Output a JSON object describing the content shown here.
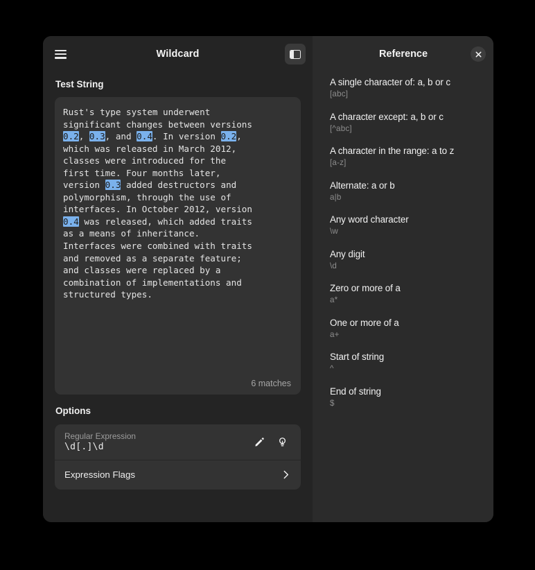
{
  "window": {
    "title": "Wildcard"
  },
  "header": {
    "menu_icon": "hamburger-icon",
    "title": "Wildcard",
    "sidebar_toggle_icon": "sidebar-toggle-icon"
  },
  "test_string": {
    "label": "Test String",
    "segments": [
      {
        "text": "Rust's type system underwent\nsignificant changes between versions\n",
        "match": false
      },
      {
        "text": "0.2",
        "match": true
      },
      {
        "text": ", ",
        "match": false
      },
      {
        "text": "0.3",
        "match": true
      },
      {
        "text": ", and ",
        "match": false
      },
      {
        "text": "0.4",
        "match": true
      },
      {
        "text": ". In version ",
        "match": false
      },
      {
        "text": "0.2",
        "match": true
      },
      {
        "text": ",\nwhich was released in March 2012,\nclasses were introduced for the\nfirst time. Four months later,\nversion ",
        "match": false
      },
      {
        "text": "0.3",
        "match": true
      },
      {
        "text": " added destructors and\npolymorphism, through the use of\ninterfaces. In October 2012, version\n",
        "match": false
      },
      {
        "text": "0.4",
        "match": true
      },
      {
        "text": " was released, which added traits\nas a means of inheritance.\nInterfaces were combined with traits\nand removed as a separate feature;\nand classes were replaced by a\ncombination of implementations and\nstructured types.",
        "match": false
      }
    ],
    "plain_text": "Rust's type system underwent significant changes between versions 0.2, 0.3, and 0.4. In version 0.2, which was released in March 2012, classes were introduced for the first time. Four months later, version 0.3 added destructors and polymorphism, through the use of interfaces. In October 2012, version 0.4 was released, which added traits as a means of inheritance. Interfaces were combined with traits and removed as a separate feature; and classes were replaced by a combination of implementations and structured types.",
    "match_count_label": "6 matches",
    "match_highlight_color": "#7ab1ec"
  },
  "options": {
    "label": "Options",
    "regex": {
      "field_label": "Regular Expression",
      "value": "\\d[.]\\d",
      "edit_icon": "pencil-icon",
      "hint_icon": "lightbulb-icon"
    },
    "flags": {
      "label": "Expression Flags",
      "chevron_icon": "chevron-right-icon"
    }
  },
  "reference": {
    "title": "Reference",
    "close_icon": "close-icon",
    "items": [
      {
        "title": "A single character of: a, b or c",
        "syntax": "[abc]"
      },
      {
        "title": "A character except: a, b or c",
        "syntax": "[^abc]"
      },
      {
        "title": "A character in the range: a to z",
        "syntax": "[a-z]"
      },
      {
        "title": "Alternate: a or b",
        "syntax": "a|b"
      },
      {
        "title": "Any word character",
        "syntax": "\\w"
      },
      {
        "title": "Any digit",
        "syntax": "\\d"
      },
      {
        "title": "Zero or more of a",
        "syntax": "a*"
      },
      {
        "title": "One or more of a",
        "syntax": "a+"
      },
      {
        "title": "Start of string",
        "syntax": "^"
      },
      {
        "title": "End of string",
        "syntax": "$"
      }
    ]
  }
}
